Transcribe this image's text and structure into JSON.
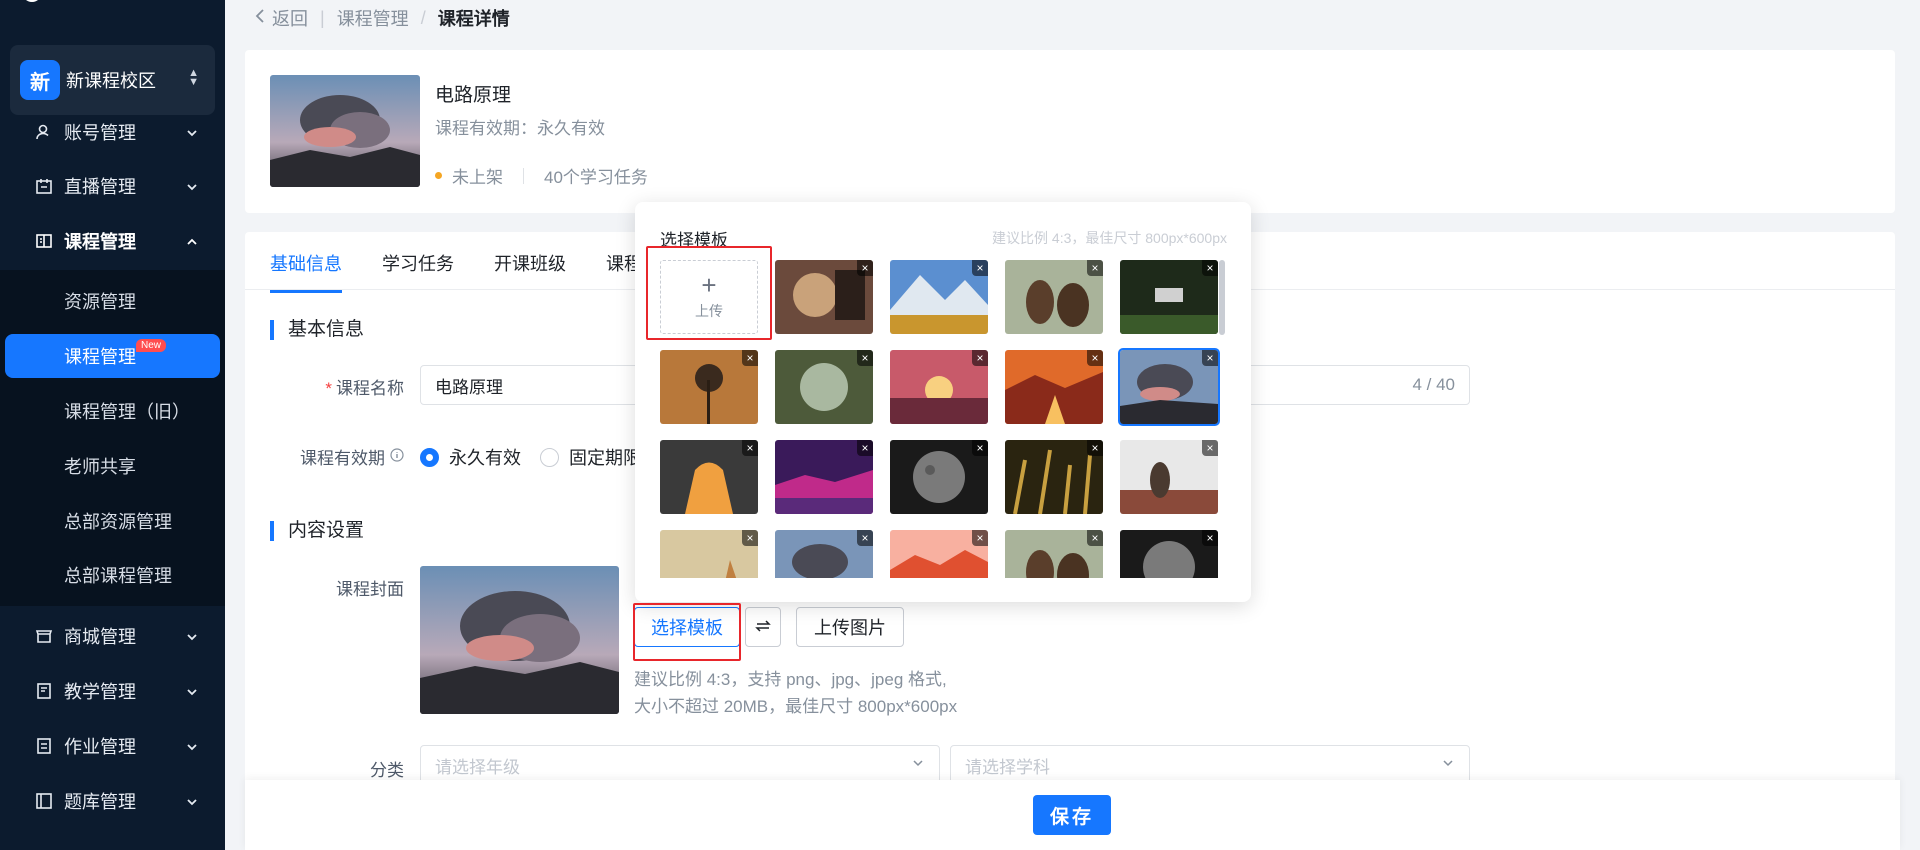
{
  "sidebar": {
    "campus": {
      "badge": "新",
      "name": "新课程校区"
    },
    "menu": [
      {
        "label": "账号管理",
        "icon": "user-icon"
      },
      {
        "label": "直播管理",
        "icon": "calendar-icon"
      },
      {
        "label": "课程管理",
        "icon": "book-icon"
      },
      {
        "label": "商城管理",
        "icon": "shop-icon"
      },
      {
        "label": "教学管理",
        "icon": "teaching-icon"
      },
      {
        "label": "作业管理",
        "icon": "homework-icon"
      },
      {
        "label": "题库管理",
        "icon": "question-bank-icon"
      }
    ],
    "submenu": [
      {
        "label": "资源管理"
      },
      {
        "label": "课程管理",
        "tag": "New"
      },
      {
        "label": "课程管理（旧）"
      },
      {
        "label": "老师共享"
      },
      {
        "label": "总部资源管理"
      },
      {
        "label": "总部课程管理"
      }
    ]
  },
  "breadcrumb": {
    "back": "返回",
    "parent": "课程管理",
    "separator": "/",
    "current": "课程详情"
  },
  "course": {
    "title": "电路原理",
    "validity": "课程有效期：永久有效",
    "status": "未上架",
    "tasks": "40个学习任务"
  },
  "tabs": [
    "基础信息",
    "学习任务",
    "开课班级",
    "课程"
  ],
  "basic": {
    "section": "基本信息",
    "name_label": "课程名称",
    "name_value": "电路原理",
    "name_count": "4 / 40",
    "validity_label": "课程有效期",
    "validity_options": [
      "永久有效",
      "固定期限"
    ]
  },
  "content": {
    "section": "内容设置",
    "cover_label": "课程封面",
    "choose_template": "选择模板",
    "upload_image": "上传图片",
    "hint_line1": "建议比例 4:3，支持 png、jpg、jpeg 格式,",
    "hint_line2": "大小不超过 20MB，最佳尺寸 800px*600px",
    "category_label": "分类",
    "grade_placeholder": "请选择年级",
    "subject_placeholder": "请选择学科"
  },
  "popover": {
    "title": "选择模板",
    "hint": "建议比例 4:3，最佳尺寸 800px*600px",
    "upload": "上传",
    "remove_glyph": "×"
  },
  "footer": {
    "save": "保存"
  },
  "colors": {
    "primary": "#1677ff",
    "sidebar": "#0c1b2e",
    "highlight": "#e8262b",
    "status_dot": "#f5a623"
  }
}
